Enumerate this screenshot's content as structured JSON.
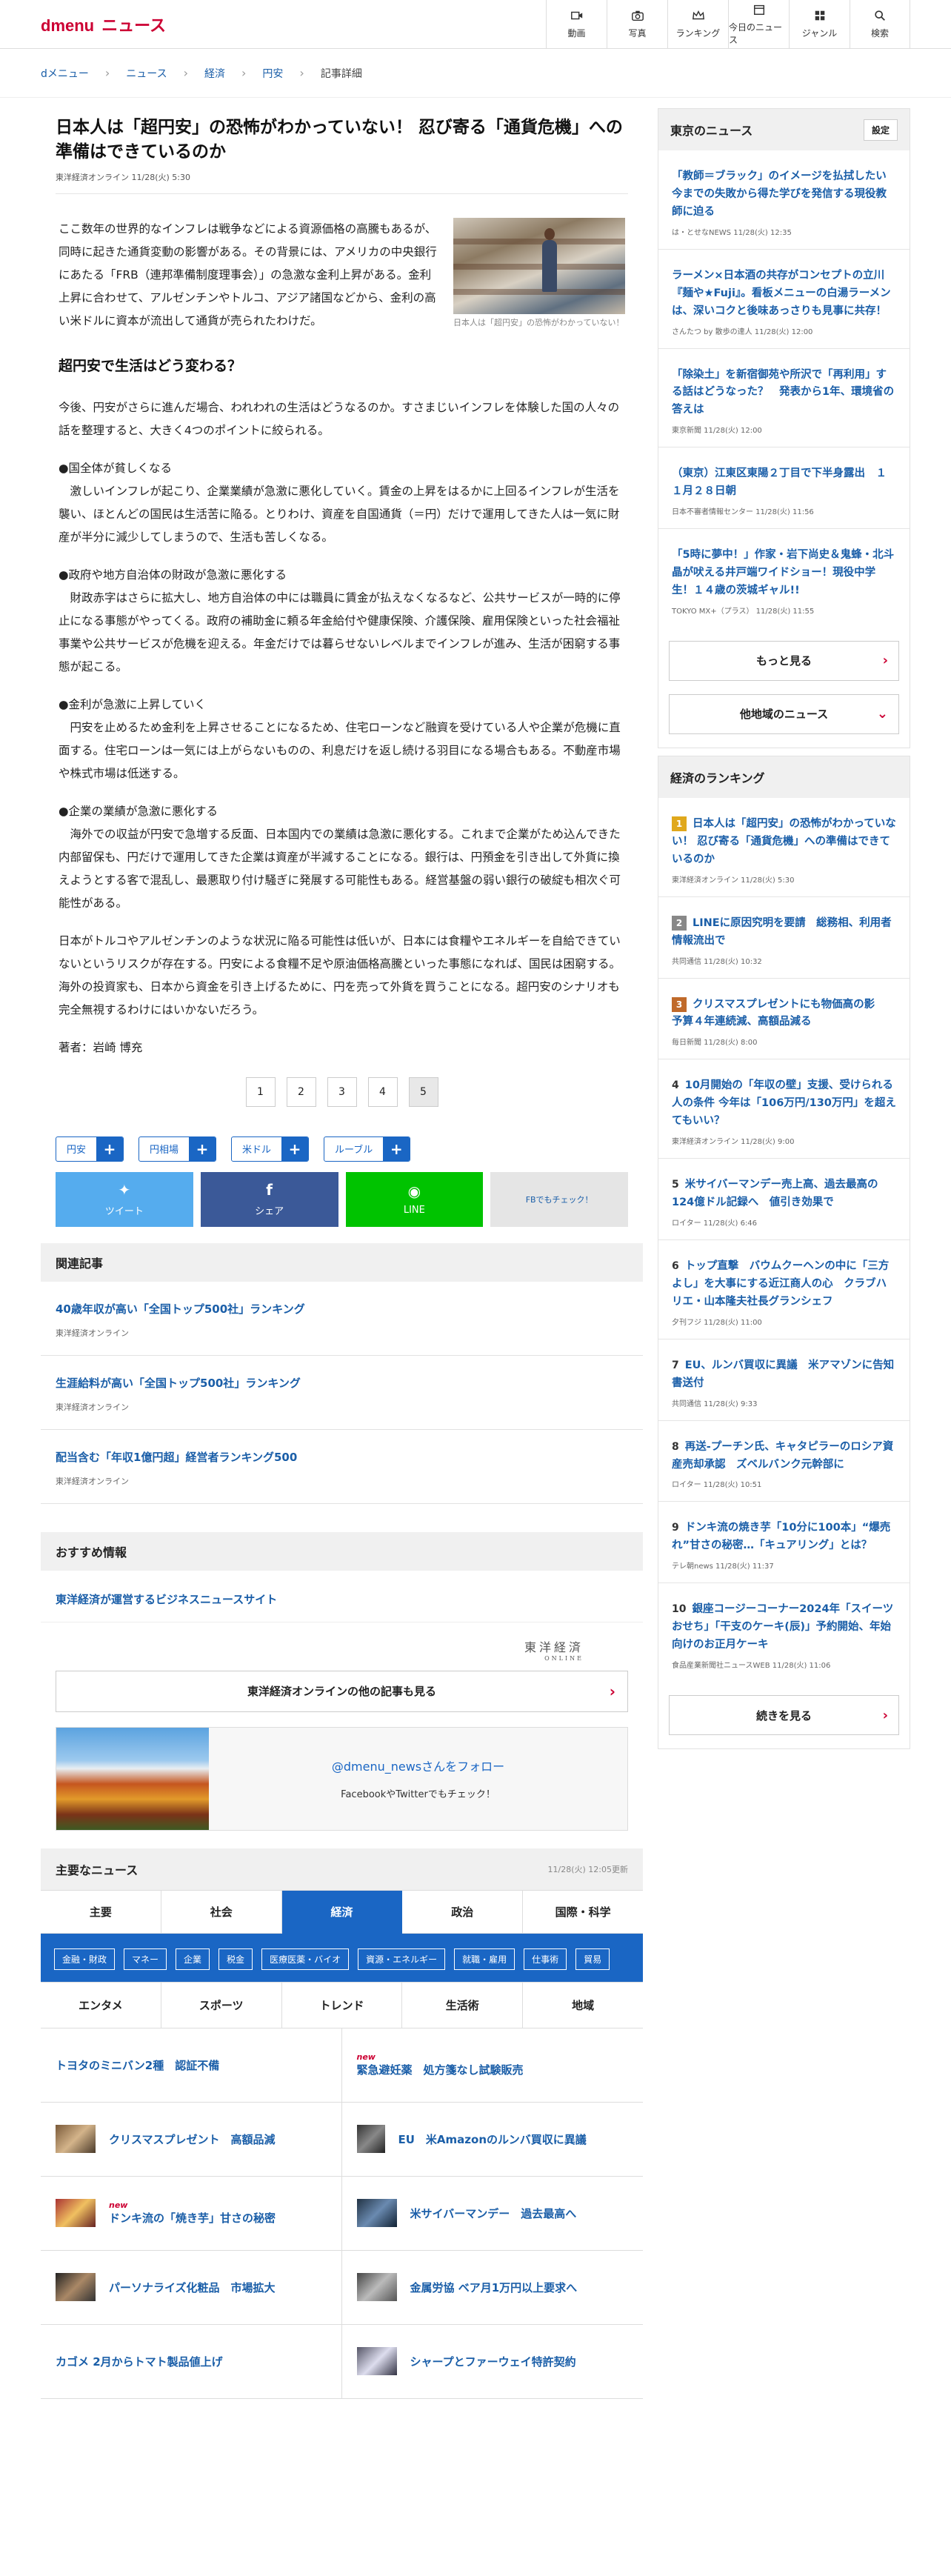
{
  "header": {
    "logo_d": "dmenu",
    "logo_news": "ニュース",
    "nav": [
      {
        "label": "動画",
        "icon": "video-icon"
      },
      {
        "label": "写真",
        "icon": "camera-icon"
      },
      {
        "label": "ランキング",
        "icon": "crown-icon"
      },
      {
        "label": "今日のニュース",
        "icon": "calendar-icon"
      },
      {
        "label": "ジャンル",
        "icon": "grid-icon"
      },
      {
        "label": "検索",
        "icon": "search-icon"
      }
    ]
  },
  "breadcrumb": [
    "dメニュー",
    "ニュース",
    "経済",
    "円安",
    "記事詳細"
  ],
  "article": {
    "title": "日本人は「超円安」の恐怖がわかっていない！ 忍び寄る「通貨危機」への準備はできているのか",
    "source": "東洋経済オンライン  11/28(火) 5:30",
    "lead": "ここ数年の世界的なインフレは戦争などによる資源価格の高騰もあるが、同時に起きた通貨変動の影響がある。その背景には、アメリカの中央銀行にあたる「FRB（連邦準備制度理事会）」の急激な金利上昇がある。金利上昇に合わせて、アルゼンチンやトルコ、アジア諸国などから、金利の高い米ドルに資本が流出して通貨が売られたわけだ。",
    "photo_caption": "日本人は「超円安」の恐怖がわかっていない！",
    "h2": "超円安で生活はどう変わる？",
    "paragraphs": [
      "今後、円安がさらに進んだ場合、われわれの生活はどうなるのか。すさまじいインフレを体験した国の人々の話を整理すると、大きく4つのポイントに絞られる。",
      "●国全体が貧しくなる\n　激しいインフレが起こり、企業業績が急激に悪化していく。賃金の上昇をはるかに上回るインフレが生活を襲い、ほとんどの国民は生活苦に陥る。とりわけ、資産を自国通貨（＝円）だけで運用してきた人は一気に財産が半分に減少してしまうので、生活も苦しくなる。",
      "●政府や地方自治体の財政が急激に悪化する\n　財政赤字はさらに拡大し、地方自治体の中には職員に賃金が払えなくなるなど、公共サービスが一時的に停止になる事態がやってくる。政府の補助金に頼る年金給付や健康保険、介護保険、雇用保険といった社会福祉事業や公共サービスが危機を迎える。年金だけでは暮らせないレベルまでインフレが進み、生活が困窮する事態が起こる。",
      "●金利が急激に上昇していく\n　円安を止めるため金利を上昇させることになるため、住宅ローンなど融資を受けている人や企業が危機に直面する。住宅ローンは一気には上がらないものの、利息だけを返し続ける羽目になる場合もある。不動産市場や株式市場は低迷する。",
      "●企業の業績が急激に悪化する\n　海外での収益が円安で急増する反面、日本国内での業績は急激に悪化する。これまで企業がため込んできた内部留保も、円だけで運用してきた企業は資産が半減することになる。銀行は、円預金を引き出して外貨に換えようとする客で混乱し、最悪取り付け騒ぎに発展する可能性もある。経営基盤の弱い銀行の破綻も相次ぐ可能性がある。",
      "日本がトルコやアルゼンチンのような状況に陥る可能性は低いが、日本には食糧やエネルギーを自給できていないというリスクが存在する。円安による食糧不足や原油価格高騰といった事態になれば、国民は困窮する。海外の投資家も、日本から資金を引き上げるために、円を売って外貨を買うことになる。超円安のシナリオも完全無視するわけにはいかないだろう。"
    ],
    "author": "著者：岩崎 博充",
    "pages": [
      "1",
      "2",
      "3",
      "4",
      "5"
    ],
    "active_page": "5"
  },
  "tags": [
    "円安",
    "円相場",
    "米ドル",
    "ルーブル"
  ],
  "share": {
    "twitter": "ツイート",
    "facebook": "シェア",
    "line": "LINE",
    "check": "FBでもチェック！"
  },
  "related": {
    "heading": "関連記事",
    "items": [
      {
        "title": "40歳年収が高い「全国トップ500社」ランキング",
        "source": "東洋経済オンライン"
      },
      {
        "title": "生涯給料が高い「全国トップ500社」ランキング",
        "source": "東洋経済オンライン"
      },
      {
        "title": "配当含む「年収1億円超」経営者ランキング500",
        "source": "東洋経済オンライン"
      }
    ]
  },
  "recommend": {
    "heading": "おすすめ情報",
    "link": "東洋経済が運営するビジネスニュースサイト",
    "logo": "東洋経済",
    "logo_sub": "ONLINE",
    "more": "東洋経済オンラインの他の記事も見る",
    "follow_handle": "@dmenu_newsさんをフォロー",
    "follow_sub": "FacebookやTwitterでもチェック！"
  },
  "major": {
    "heading": "主要なニュース",
    "updated": "11/28(火) 12:05更新",
    "tabs": [
      "主要",
      "社会",
      "経済",
      "政治",
      "国際・科学"
    ],
    "active_tab": "経済",
    "chips": [
      "金融・財政",
      "マネー",
      "企業",
      "税金",
      "医療医薬・バイオ",
      "資源・エネルギー",
      "就職・雇用",
      "仕事術",
      "貿易"
    ],
    "tabs2": [
      "エンタメ",
      "スポーツ",
      "トレンド",
      "生活術",
      "地域"
    ],
    "items": [
      {
        "title": "トヨタのミニバン2種　認証不備",
        "new": "",
        "thumb": false
      },
      {
        "title": "緊急避妊薬　処方箋なし試験販売",
        "new": "new",
        "thumb": false
      },
      {
        "title": "クリスマスプレゼント　高額品減",
        "new": "",
        "thumb": true
      },
      {
        "title": "EU　米Amazonのルンバ買収に異議",
        "new": "",
        "thumb": true
      },
      {
        "title": "ドンキ流の「焼き芋」甘さの秘密",
        "new": "new",
        "thumb": true
      },
      {
        "title": "米サイバーマンデー　過去最高へ",
        "new": "",
        "thumb": true
      },
      {
        "title": "パーソナライズ化粧品　市場拡大",
        "new": "",
        "thumb": true
      },
      {
        "title": "金属労協 ベア月1万円以上要求へ",
        "new": "",
        "thumb": true
      },
      {
        "title": "カゴメ 2月からトマト製品値上げ",
        "new": "",
        "thumb": false
      },
      {
        "title": "シャープとファーウェイ特許契約",
        "new": "",
        "thumb": true
      }
    ]
  },
  "tokyo": {
    "heading": "東京のニュース",
    "setting": "設定",
    "items": [
      {
        "title": "「教師＝ブラック」のイメージを払拭したい　今までの失敗から得た学びを発信する現役教師に迫る",
        "source": "は・とせなNEWS  11/28(火) 12:35"
      },
      {
        "title": "ラーメン×日本酒の共存がコンセプトの立川『麺や★Fuji』。看板メニューの白湯ラーメンは、深いコクと後味あっさりも見事に共存！",
        "source": "さんたつ by 散歩の達人  11/28(火) 12:00"
      },
      {
        "title": "「除染土」を新宿御苑や所沢で「再利用」する話はどうなった？　発表から1年、環境省の答えは",
        "source": "東京新聞  11/28(火) 12:00"
      },
      {
        "title": "（東京）江東区東陽２丁目で下半身露出　１１月２８日朝",
        "source": "日本不審者情報センター  11/28(火) 11:56"
      },
      {
        "title": "「5時に夢中！」作家・岩下尚史＆鬼蜂・北斗晶が吠える井戸端ワイドショー！現役中学生！１４歳の茨城ギャル!!",
        "source": "TOKYO MX+（プラス）  11/28(火) 11:55"
      }
    ],
    "more": "もっと見る",
    "other": "他地域のニュース"
  },
  "ranking": {
    "heading": "経済のランキング",
    "items": [
      {
        "n": "1",
        "title": "日本人は「超円安」の恐怖がわかっていない！ 忍び寄る「通貨危機」への準備はできているのか",
        "source": "東洋経済オンライン  11/28(火) 5:30"
      },
      {
        "n": "2",
        "title": "LINEに原因究明を要請　総務相、利用者情報流出で",
        "source": "共同通信  11/28(火) 10:32"
      },
      {
        "n": "3",
        "title": "クリスマスプレゼントにも物価高の影　予算４年連続減、高額品減る",
        "source": "毎日新聞  11/28(火) 8:00"
      },
      {
        "n": "4",
        "title": "10月開始の「年収の壁」支援、受けられる人の条件 今年は「106万円/130万円」を超えてもいい？",
        "source": "東洋経済オンライン  11/28(火) 9:00"
      },
      {
        "n": "5",
        "title": "米サイバーマンデー売上高、過去最高の124億ドル記録へ　値引き効果で",
        "source": "ロイター  11/28(火) 6:46"
      },
      {
        "n": "6",
        "title": "トップ直撃　バウムクーヘンの中に「三方よし」を大事にする近江商人の心　クラブハリエ・山本隆夫社長グランシェフ",
        "source": "夕刊フジ  11/28(火) 11:00"
      },
      {
        "n": "7",
        "title": "EU、ルンバ買収に異議　米アマゾンに告知書送付",
        "source": "共同通信  11/28(火) 9:33"
      },
      {
        "n": "8",
        "title": "再送-プーチン氏、キャタピラーのロシア資産売却承認　ズベルバンク元幹部に",
        "source": "ロイター  11/28(火) 10:51"
      },
      {
        "n": "9",
        "title": "ドンキ流の焼き芋「10分に100本」“爆売れ”甘さの秘密…「キュアリング」とは？",
        "source": "テレ朝news  11/28(火) 11:37"
      },
      {
        "n": "10",
        "title": "銀座コージーコーナー2024年「スイーツおせち」「干支のケーキ(辰)」予約開始、年始向けのお正月ケーキ",
        "source": "食品産業新聞社ニュースWEB  11/28(火) 11:06"
      }
    ],
    "more": "続きを見る"
  }
}
